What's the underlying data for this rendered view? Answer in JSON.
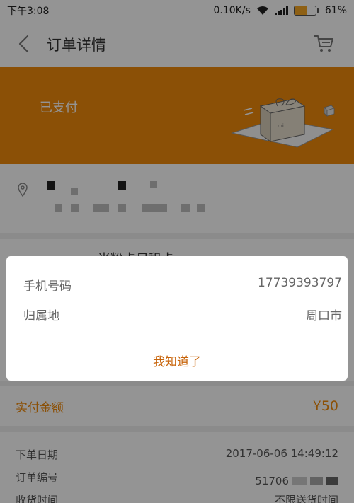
{
  "status_bar": {
    "time": "下午3:08",
    "network_speed": "0.10K/s",
    "battery_percent": "61%",
    "battery_level": 0.61,
    "battery_color": "#f5a623"
  },
  "header": {
    "title": "订单详情",
    "back_icon": "chevron-left-icon",
    "cart_icon": "cart-icon"
  },
  "banner": {
    "status": "已支付",
    "bg_color": "#f08a0b",
    "illustration_icon": "gift-box-icon"
  },
  "address": {
    "location_icon": "location-pin-icon"
  },
  "product": {
    "name_partial": "米粉卡日租卡"
  },
  "payment": {
    "label": "实付金额",
    "amount": "¥50"
  },
  "order_info": {
    "rows": [
      {
        "label": "下单日期",
        "value": "2017-06-06 14:49:12"
      },
      {
        "label": "订单编号",
        "value": "51706"
      },
      {
        "label": "收货时间",
        "value": "不限送货时间"
      }
    ]
  },
  "dialog": {
    "phone_label": "手机号码",
    "phone_value": "17739393797",
    "region_label": "归属地",
    "region_value": "周口市",
    "confirm_button": "我知道了",
    "accent_color": "#c8640a"
  }
}
